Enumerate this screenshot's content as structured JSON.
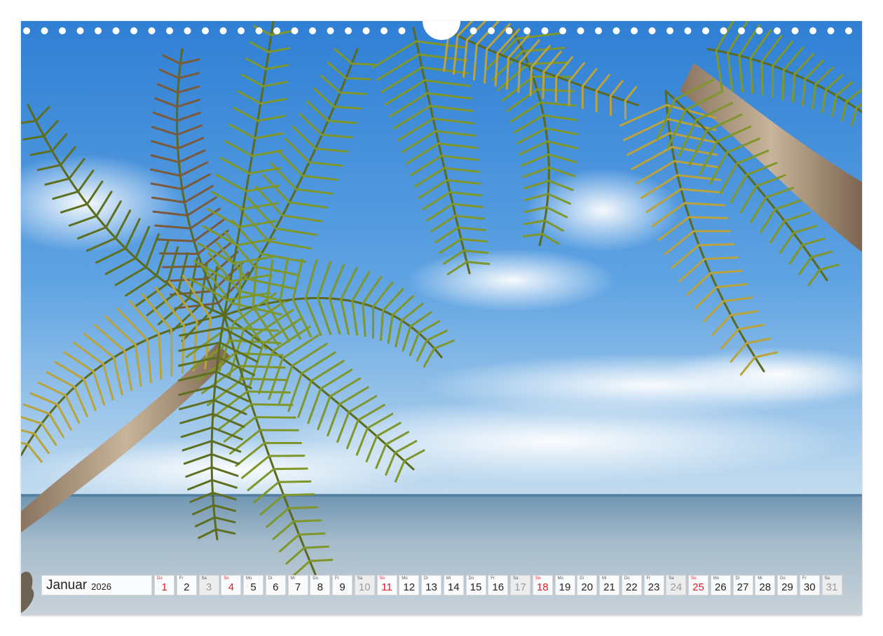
{
  "calendar": {
    "month": "Januar",
    "year": "2026",
    "days": [
      {
        "wd": "Do",
        "n": "1",
        "type": "sunday"
      },
      {
        "wd": "Fr",
        "n": "2",
        "type": "weekday"
      },
      {
        "wd": "Sa",
        "n": "3",
        "type": "weekend"
      },
      {
        "wd": "So",
        "n": "4",
        "type": "sunday"
      },
      {
        "wd": "Mo",
        "n": "5",
        "type": "weekday"
      },
      {
        "wd": "Di",
        "n": "6",
        "type": "weekday"
      },
      {
        "wd": "Mi",
        "n": "7",
        "type": "weekday"
      },
      {
        "wd": "Do",
        "n": "8",
        "type": "weekday"
      },
      {
        "wd": "Fr",
        "n": "9",
        "type": "weekday"
      },
      {
        "wd": "Sa",
        "n": "10",
        "type": "weekend"
      },
      {
        "wd": "So",
        "n": "11",
        "type": "sunday"
      },
      {
        "wd": "Mo",
        "n": "12",
        "type": "weekday"
      },
      {
        "wd": "Di",
        "n": "13",
        "type": "weekday"
      },
      {
        "wd": "Mi",
        "n": "14",
        "type": "weekday"
      },
      {
        "wd": "Do",
        "n": "15",
        "type": "weekday"
      },
      {
        "wd": "Fr",
        "n": "16",
        "type": "weekday"
      },
      {
        "wd": "Sa",
        "n": "17",
        "type": "weekend"
      },
      {
        "wd": "So",
        "n": "18",
        "type": "sunday"
      },
      {
        "wd": "Mo",
        "n": "19",
        "type": "weekday"
      },
      {
        "wd": "Di",
        "n": "20",
        "type": "weekday"
      },
      {
        "wd": "Mi",
        "n": "21",
        "type": "weekday"
      },
      {
        "wd": "Do",
        "n": "22",
        "type": "weekday"
      },
      {
        "wd": "Fr",
        "n": "23",
        "type": "weekday"
      },
      {
        "wd": "Sa",
        "n": "24",
        "type": "weekend"
      },
      {
        "wd": "So",
        "n": "25",
        "type": "sunday"
      },
      {
        "wd": "Mo",
        "n": "26",
        "type": "weekday"
      },
      {
        "wd": "Di",
        "n": "27",
        "type": "weekday"
      },
      {
        "wd": "Mi",
        "n": "28",
        "type": "weekday"
      },
      {
        "wd": "Do",
        "n": "29",
        "type": "weekday"
      },
      {
        "wd": "Fr",
        "n": "30",
        "type": "weekday"
      },
      {
        "wd": "Sa",
        "n": "31",
        "type": "weekend"
      }
    ]
  },
  "colors": {
    "sky_top": "#3a86d6",
    "sky_bottom": "#a9cdee",
    "sea": "#8fa9bd",
    "palm_green": "#7a8f2a",
    "sunday_red": "#e0202a"
  }
}
